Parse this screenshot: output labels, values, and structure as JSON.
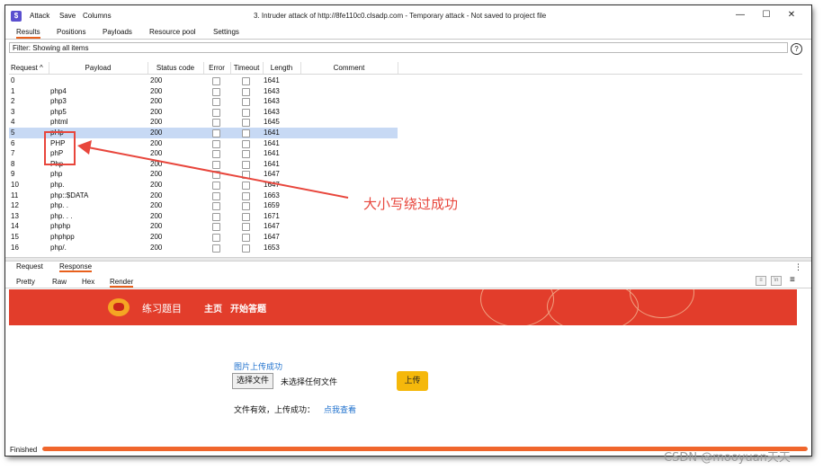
{
  "window": {
    "app_icon": "$",
    "menu": [
      "Attack",
      "Save",
      "Columns"
    ],
    "title": "3. Intruder attack of http://8fe110c0.clsadp.com - Temporary attack - Not saved to project file",
    "minimize": "—",
    "maximize": "☐",
    "close": "✕"
  },
  "tabs": [
    "Results",
    "Positions",
    "Payloads",
    "Resource pool",
    "Settings"
  ],
  "filter": {
    "text": "Filter: Showing all items",
    "help": "?"
  },
  "table": {
    "columns": [
      "Request",
      "Payload",
      "Status code",
      "Error",
      "Timeout",
      "Length",
      "Comment"
    ],
    "sort_indicator": "^",
    "rows": [
      {
        "request": "0",
        "payload": "",
        "status": "200",
        "length": "1641"
      },
      {
        "request": "1",
        "payload": "php4",
        "status": "200",
        "length": "1643"
      },
      {
        "request": "2",
        "payload": "php3",
        "status": "200",
        "length": "1643"
      },
      {
        "request": "3",
        "payload": "php5",
        "status": "200",
        "length": "1643"
      },
      {
        "request": "4",
        "payload": "phtml",
        "status": "200",
        "length": "1645"
      },
      {
        "request": "5",
        "payload": "pHp",
        "status": "200",
        "length": "1641"
      },
      {
        "request": "6",
        "payload": "PHP",
        "status": "200",
        "length": "1641"
      },
      {
        "request": "7",
        "payload": "phP",
        "status": "200",
        "length": "1641"
      },
      {
        "request": "8",
        "payload": "Php",
        "status": "200",
        "length": "1641"
      },
      {
        "request": "9",
        "payload": "php",
        "status": "200",
        "length": "1647"
      },
      {
        "request": "10",
        "payload": "php.",
        "status": "200",
        "length": "1647"
      },
      {
        "request": "11",
        "payload": "php::$DATA",
        "status": "200",
        "length": "1663"
      },
      {
        "request": "12",
        "payload": "php. .",
        "status": "200",
        "length": "1659"
      },
      {
        "request": "13",
        "payload": "php. . .",
        "status": "200",
        "length": "1671"
      },
      {
        "request": "14",
        "payload": "phphp",
        "status": "200",
        "length": "1647"
      },
      {
        "request": "15",
        "payload": "phphpp",
        "status": "200",
        "length": "1647"
      },
      {
        "request": "16",
        "payload": "php/.",
        "status": "200",
        "length": "1653"
      }
    ],
    "selected_index": 5
  },
  "annotation": {
    "text": "大小写绕过成功",
    "color": "#e8463c"
  },
  "subtabs": [
    "Request",
    "Response"
  ],
  "viewtabs": [
    "Pretty",
    "Raw",
    "Hex",
    "Render"
  ],
  "render": {
    "banner_color": "#e23d2b",
    "banner_title": "练习题目",
    "nav": [
      "主页",
      "开始答题"
    ],
    "upload_title": "图片上传成功",
    "file_button": "选择文件",
    "file_none": "未选择任何文件",
    "upload_button": "上传",
    "result_text": "文件有效，上传成功：",
    "result_link": "点我查看"
  },
  "status": {
    "text": "Finished",
    "progress": 1.0
  },
  "watermark": "CSDN @mooyuan天天",
  "icons": [
    "burp-app-icon",
    "help-icon",
    "checkbox-icon",
    "kebab-icon",
    "hamburger-icon",
    "lion-icon",
    "lantern-icon"
  ]
}
